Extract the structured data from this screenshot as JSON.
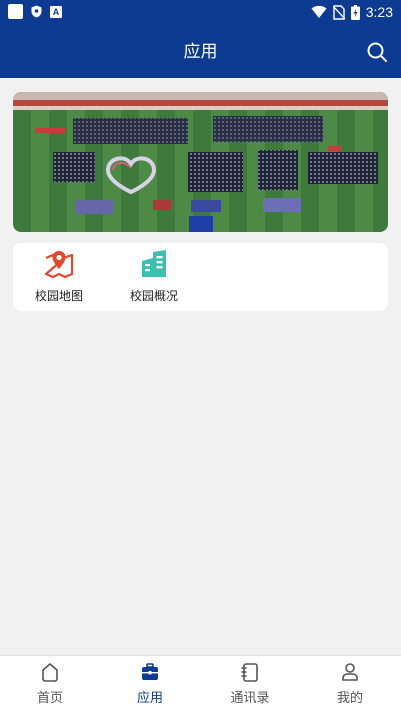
{
  "status_bar": {
    "time": "3:23",
    "left_icons": [
      "app-icon",
      "shield-icon",
      "text-a-icon"
    ],
    "right_icons": [
      "wifi-icon",
      "no-sim-icon",
      "battery-icon"
    ]
  },
  "header": {
    "title": "应用",
    "search_icon": "search-icon"
  },
  "banner": {
    "image": "campus-field-formation-photo"
  },
  "apps": [
    {
      "label": "校园地图",
      "icon": "map-pin-icon",
      "color": "#e0492f"
    },
    {
      "label": "校园概况",
      "icon": "building-icon",
      "color": "#3cc0b0"
    }
  ],
  "bottom_nav": {
    "active": "应用",
    "items": [
      {
        "label": "首页",
        "icon": "home-icon"
      },
      {
        "label": "应用",
        "icon": "briefcase-icon"
      },
      {
        "label": "通讯录",
        "icon": "contacts-book-icon"
      },
      {
        "label": "我的",
        "icon": "person-icon"
      }
    ]
  },
  "colors": {
    "primary": "#0d3b91",
    "background": "#f1f1f1",
    "card": "#ffffff"
  }
}
